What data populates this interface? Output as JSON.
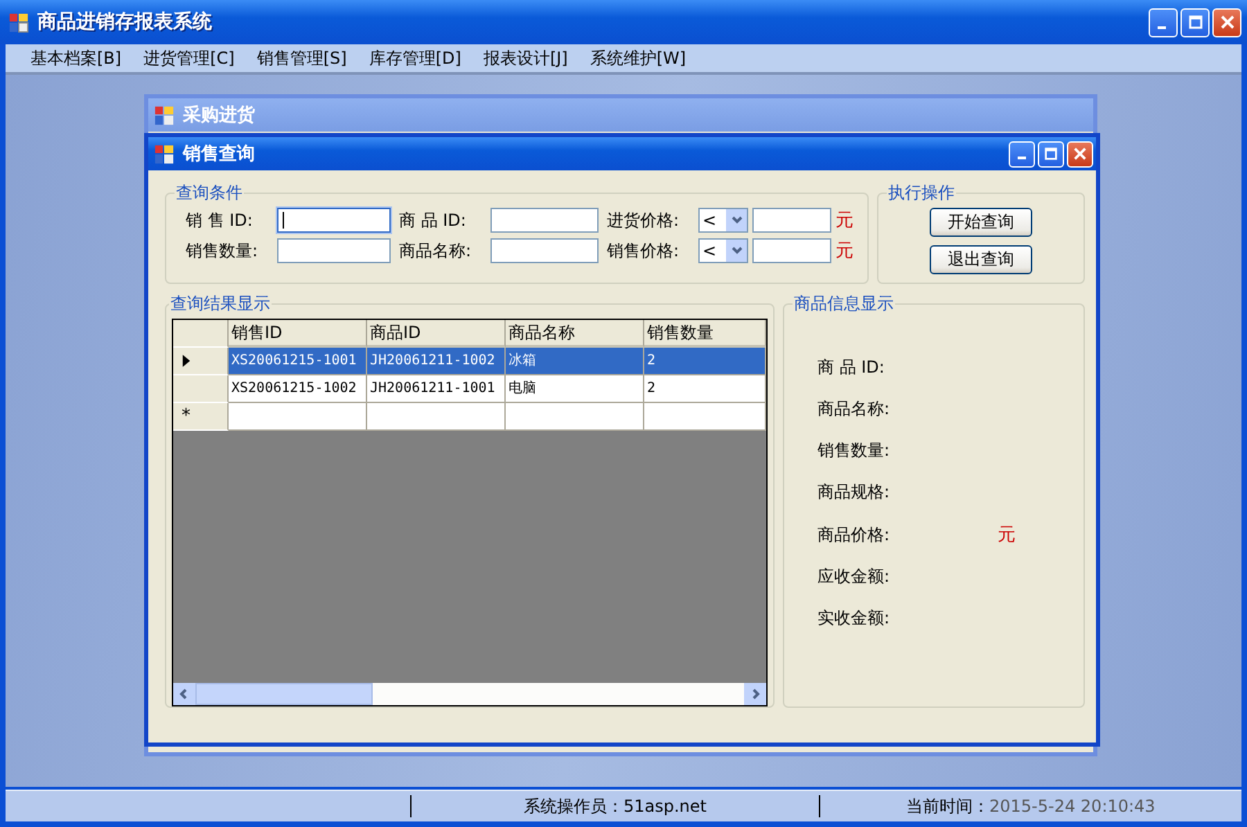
{
  "window": {
    "title": "商品进销存报表系统"
  },
  "menu": [
    "基本档案[B]",
    "进货管理[C]",
    "销售管理[S]",
    "库存管理[D]",
    "报表设计[J]",
    "系统维护[W]"
  ],
  "back_window": {
    "title": "采购进货"
  },
  "dialog": {
    "title": "销售查询",
    "criteria": {
      "title": "查询条件",
      "fields": [
        {
          "kind": "text",
          "label": "销 售 ID:",
          "focused": true
        },
        {
          "kind": "text",
          "label": "商 品 ID:",
          "focused": false
        },
        {
          "kind": "price",
          "label": "进货价格:",
          "operator": "<",
          "unit": "元"
        },
        {
          "kind": "text",
          "label": "销售数量:",
          "focused": false
        },
        {
          "kind": "text",
          "label": "商品名称:",
          "focused": false
        },
        {
          "kind": "price",
          "label": "销售价格:",
          "operator": "<",
          "unit": "元"
        }
      ]
    },
    "actions": {
      "title": "执行操作",
      "buttons": [
        "开始查询",
        "退出查询"
      ]
    },
    "results": {
      "title": "查询结果显示",
      "columns": [
        "销售ID",
        "商品ID",
        "商品名称",
        "销售数量"
      ],
      "rows": [
        {
          "cells": [
            "XS20061215-1001",
            "JH20061211-1002",
            "冰箱",
            "2"
          ],
          "selected": true
        },
        {
          "cells": [
            "XS20061215-1002",
            "JH20061211-1001",
            "电脑",
            "2"
          ],
          "selected": false
        }
      ],
      "new_row_marker": "*"
    },
    "info": {
      "title": "商品信息显示",
      "fields": [
        {
          "label": "商 品 ID:"
        },
        {
          "label": "商品名称:"
        },
        {
          "label": "销售数量:"
        },
        {
          "label": "商品规格:"
        },
        {
          "label": "商品价格:",
          "unit": "元"
        },
        {
          "label": "应收金额:"
        },
        {
          "label": "实收金额:"
        }
      ]
    }
  },
  "status_bar": {
    "operator": "系统操作员：51asp.net",
    "time_label": "当前时间：",
    "time": "2015-5-24 20:10:43"
  }
}
